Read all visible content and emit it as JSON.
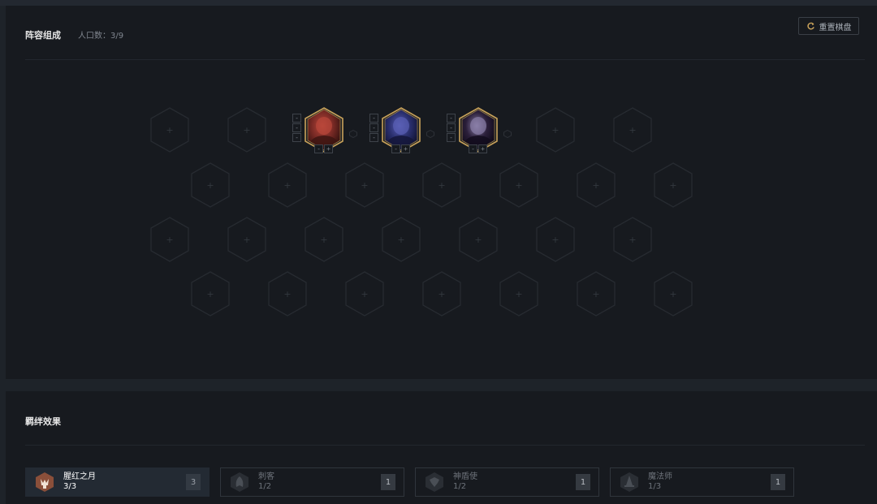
{
  "board": {
    "title": "阵容组成",
    "population": "人口数：3/9",
    "reset_label": "重置棋盘",
    "plus_symbol": "+",
    "minus_symbol": "-"
  },
  "champions": [
    {
      "name": "red-armored-champion",
      "colors": [
        "#7a2a25",
        "#b9473a",
        "#3d1512"
      ]
    },
    {
      "name": "blue-hooded-champion",
      "colors": [
        "#2a2f6e",
        "#5a5fb5",
        "#14163a"
      ]
    },
    {
      "name": "dark-purple-champion",
      "colors": [
        "#2b1f3a",
        "#8a7fa8",
        "#120c1c"
      ]
    }
  ],
  "traits": {
    "title": "羁绊效果",
    "items": [
      {
        "name": "腥红之月",
        "count": "3/3",
        "badge": "3",
        "active": true,
        "icon": "crimson-moon-icon"
      },
      {
        "name": "刺客",
        "count": "1/2",
        "badge": "1",
        "active": false,
        "icon": "assassin-icon"
      },
      {
        "name": "神盾使",
        "count": "1/2",
        "badge": "1",
        "active": false,
        "icon": "aegis-icon"
      },
      {
        "name": "魔法师",
        "count": "1/3",
        "badge": "1",
        "active": false,
        "icon": "mage-icon"
      }
    ]
  },
  "colors": {
    "gold_frame": "#c9a25a",
    "active_trait_icon": "#8a4f3a"
  }
}
